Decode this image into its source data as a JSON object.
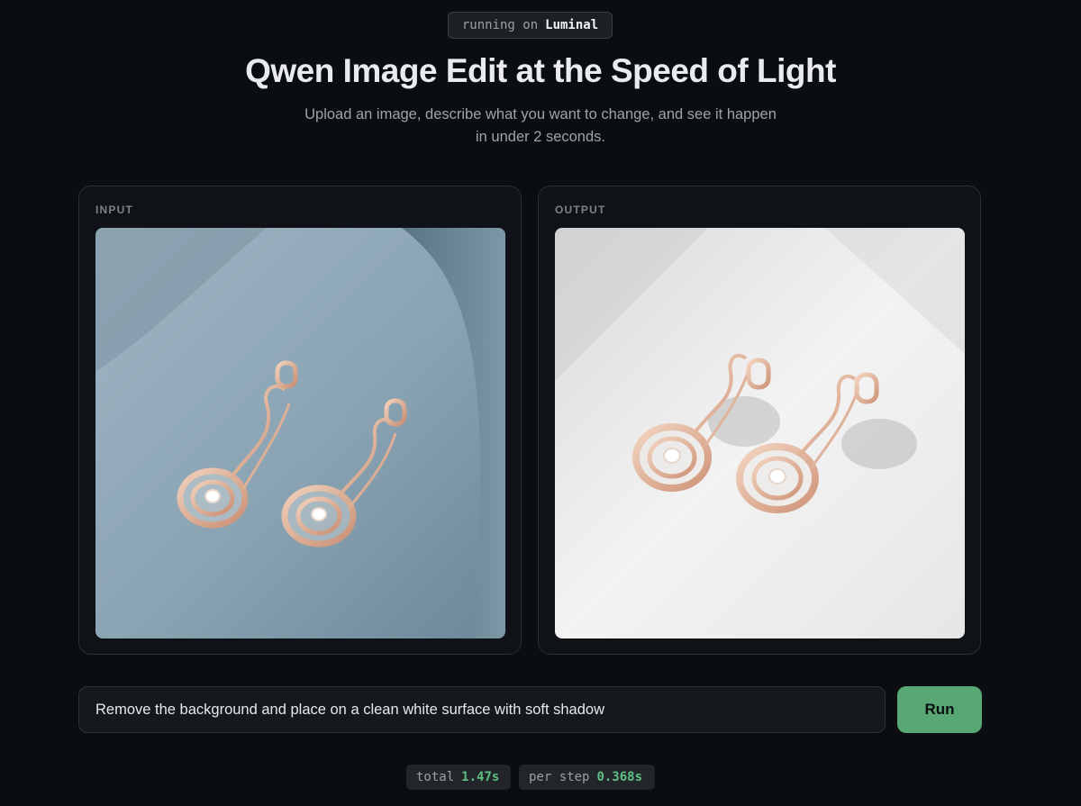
{
  "badge": {
    "prefix": "running on",
    "brand": "Luminal"
  },
  "header": {
    "title": "Qwen Image Edit at the Speed of Light",
    "subtitle": "Upload an image, describe what you want to change, and see it happen in under 2 seconds."
  },
  "panels": {
    "input": {
      "label": "INPUT"
    },
    "output": {
      "label": "OUTPUT"
    }
  },
  "prompt": {
    "value": "Remove the background and place on a clean white surface with soft shadow"
  },
  "run_button": {
    "label": "Run"
  },
  "stats": {
    "total": {
      "label": "total",
      "value": "1.47s"
    },
    "per_step": {
      "label": "per step",
      "value": "0.368s"
    }
  },
  "colors": {
    "background": "#0b0e11",
    "accent": "#5aa776",
    "stat_value": "#5fbf81"
  }
}
